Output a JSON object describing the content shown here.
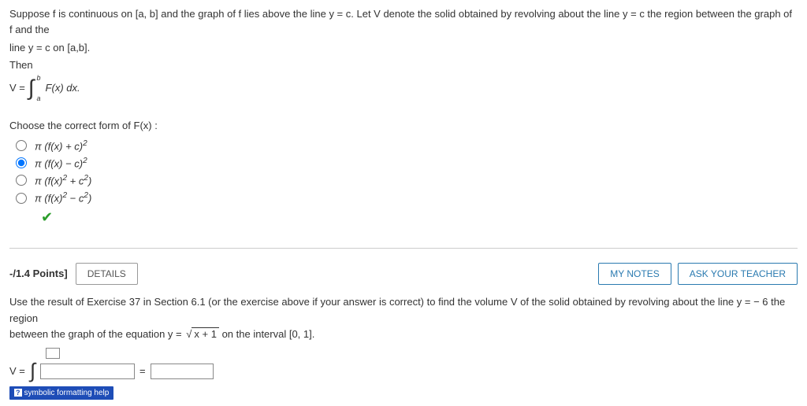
{
  "q1": {
    "intro1": "Suppose f is continuous on [a, b] and the graph of f lies above the line y = c. Let V denote the solid obtained by revolving about the line y = c the region between the graph of f and the",
    "intro2": "line y = c on [a,b].",
    "then": "Then",
    "veq": "V =",
    "integrand": "F(x) dx.",
    "upper": "b",
    "lower": "a",
    "choose": "Choose the correct form of  F(x) :",
    "opt1": "π (f(x) + c)²",
    "opt2": "π (f(x) − c)²",
    "opt3": "π (f(x)² + c²)",
    "opt4": "π (f(x)² − c²)"
  },
  "header": {
    "points": "-/1.4 Points]",
    "details": "DETAILS",
    "notes": "MY NOTES",
    "ask": "ASK YOUR TEACHER"
  },
  "q2": {
    "text1": "Use the result of Exercise 37 in Section 6.1 (or the exercise above if your answer is correct) to find the volume V of the solid obtained by revolving about the line y = − 6 the region",
    "text2_a": "between the graph of the equation  y = ",
    "text2_sqrt": "x + 1",
    "text2_b": "   on the interval [0, 1].",
    "veq": "V =",
    "eq": "=",
    "help_icon": "?",
    "help": "symbolic formatting help"
  }
}
